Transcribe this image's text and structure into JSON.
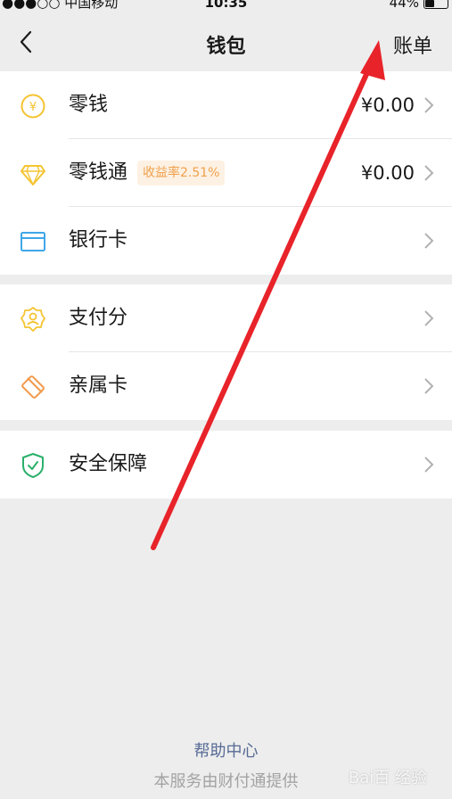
{
  "status_bar": {
    "carrier": "●●●○○ 中国移动",
    "wifi": "wifi-icon",
    "time": "10:35",
    "battery": "44%",
    "battery_level": 0.44
  },
  "nav": {
    "title": "钱包",
    "right_action": "账单"
  },
  "wallet_group": [
    {
      "icon": "yen-coin-icon",
      "label": "零钱",
      "value": "¥0.00",
      "color": "#f5c431"
    },
    {
      "icon": "diamond-icon",
      "label": "零钱通",
      "badge": "收益率2.51%",
      "value": "¥0.00",
      "color": "#f5c431"
    },
    {
      "icon": "bank-card-icon",
      "label": "银行卡",
      "value": "",
      "color": "#3fa7e8"
    }
  ],
  "service_group": [
    {
      "icon": "pay-score-icon",
      "label": "支付分",
      "color": "#f5c431"
    },
    {
      "icon": "family-card-icon",
      "label": "亲属卡",
      "color": "#f29a4b"
    }
  ],
  "security_group": [
    {
      "icon": "shield-check-icon",
      "label": "安全保障",
      "color": "#2bb06b"
    }
  ],
  "footer": {
    "help": "帮助中心",
    "provider": "本服务由财付通提供"
  },
  "watermark": "Bai百 经验",
  "colors": {
    "background": "#ededed",
    "link": "#576b95",
    "annotation_arrow": "#e8232a"
  }
}
